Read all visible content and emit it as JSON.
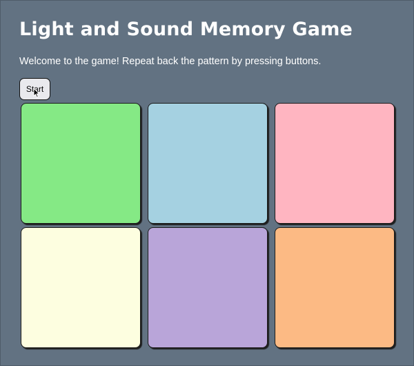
{
  "header": {
    "title": "Light and Sound Memory Game",
    "intro": "Welcome to the game! Repeat back the pattern by pressing buttons."
  },
  "controls": {
    "start_label": "Start"
  },
  "pads": [
    {
      "name": "green",
      "color": "#85e985"
    },
    {
      "name": "light-blue",
      "color": "#a5d1e1"
    },
    {
      "name": "pink",
      "color": "#ffb5c1"
    },
    {
      "name": "light-yellow",
      "color": "#fdfee0"
    },
    {
      "name": "lavender",
      "color": "#b9a5d9"
    },
    {
      "name": "orange",
      "color": "#fcba84"
    }
  ],
  "theme": {
    "background": "#627282",
    "text": "#ffffff"
  }
}
